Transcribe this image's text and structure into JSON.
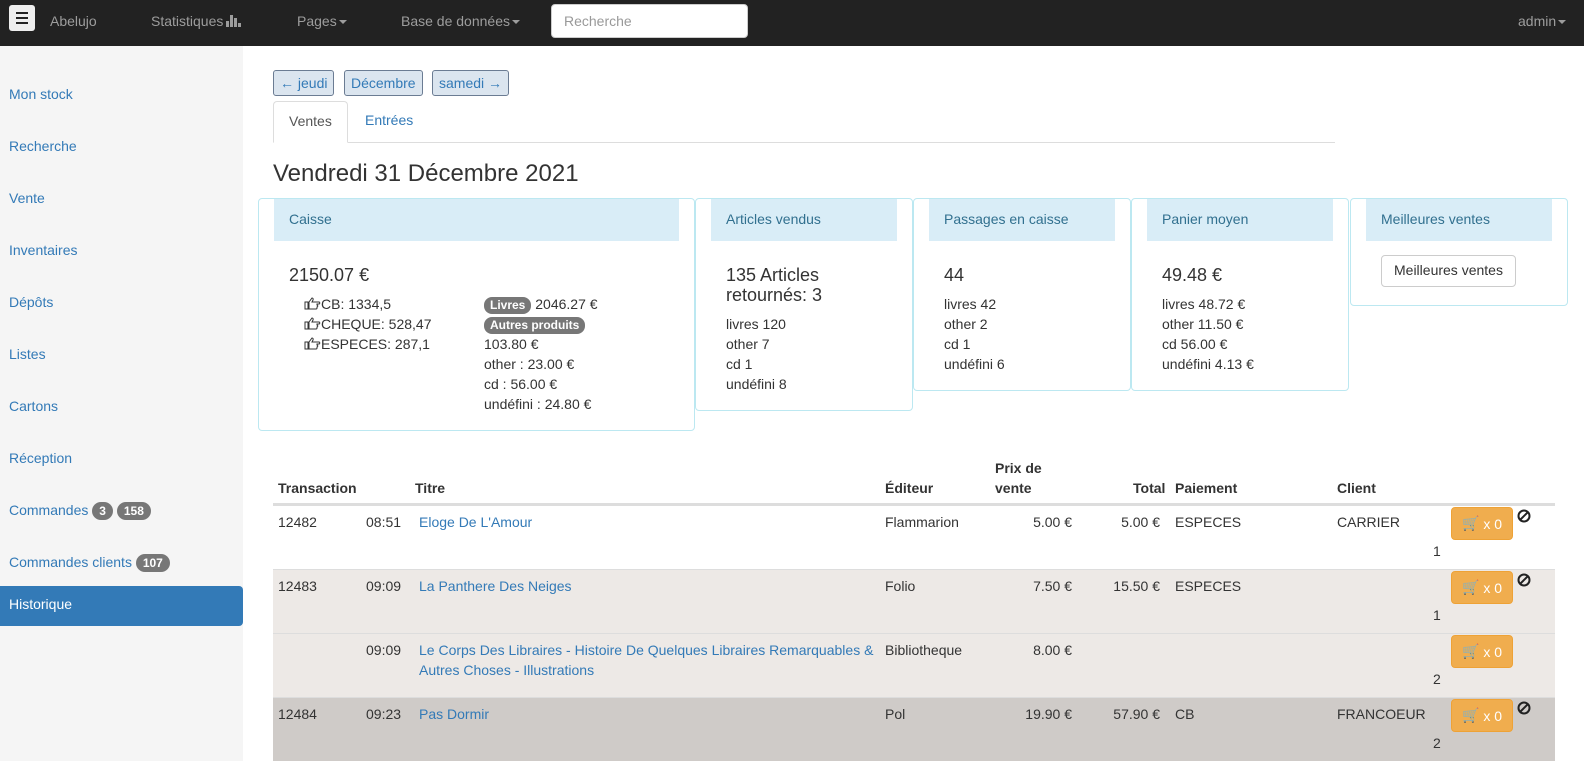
{
  "navbar": {
    "brand": "Abelujo",
    "statistiques": "Statistiques",
    "pages": "Pages",
    "base": "Base de données",
    "search_placeholder": "Recherche",
    "user": "admin"
  },
  "sidebar": {
    "items": [
      {
        "label": "Mon stock"
      },
      {
        "label": "Recherche"
      },
      {
        "label": "Vente"
      },
      {
        "label": "Inventaires"
      },
      {
        "label": "Dépôts"
      },
      {
        "label": "Listes"
      },
      {
        "label": "Cartons"
      },
      {
        "label": "Réception"
      },
      {
        "label": "Commandes",
        "badges": [
          "3",
          "158"
        ]
      },
      {
        "label": "Commandes clients",
        "badges": [
          "107"
        ]
      },
      {
        "label": "Historique"
      }
    ]
  },
  "pager": {
    "prev": "← jeudi",
    "month": "Décembre",
    "next": "samedi →"
  },
  "tabs": {
    "ventes": "Ventes",
    "entrees": "Entrées"
  },
  "title": "Vendredi 31 Décembre 2021",
  "caisse": {
    "heading": "Caisse",
    "total": "2150.07 €",
    "cb": "CB: 1334,5",
    "cheque": "CHEQUE: 528,47",
    "especes": "ESPECES: 287,1",
    "livres_label": "Livres",
    "livres_value": "2046.27 €",
    "autres_label": "Autres produits",
    "autres_value": "103.80 €",
    "other": "other : 23.00 €",
    "cd": "cd : 56.00 €",
    "undefini": "undéfini : 24.80 €"
  },
  "articles": {
    "heading": "Articles vendus",
    "line1": "135   Articles",
    "line2": "retournés: 3",
    "livres": "livres 120",
    "other": "other 7",
    "cd": "cd 1",
    "undefini": "undéfini 8"
  },
  "passages": {
    "heading": "Passages en caisse",
    "total": "44",
    "livres": "livres 42",
    "other": "other 2",
    "cd": "cd 1",
    "undefini": "undéfini 6"
  },
  "panier": {
    "heading": "Panier moyen",
    "total": "49.48 €",
    "livres": "livres 48.72 €",
    "other": "other 11.50 €",
    "cd": "cd 56.00 €",
    "undefini": "undéfini 4.13 €"
  },
  "meilleures": {
    "heading": "Meilleures ventes",
    "button": "Meilleures ventes"
  },
  "table": {
    "headers": {
      "transaction": "Transaction",
      "titre": "Titre",
      "editeur": "Éditeur",
      "prix1": "Prix de",
      "prix2": "vente",
      "total": "Total",
      "paiement": "Paiement",
      "client": "Client"
    },
    "rows": [
      {
        "id": "12482",
        "time": "08:51",
        "title": "Eloge De L'Amour",
        "editeur": "Flammarion",
        "prix": "5.00 €",
        "total": "5.00 €",
        "paiement": "ESPECES",
        "client": "CARRIER",
        "cart": "x 0",
        "qty": "1"
      },
      {
        "id": "12483",
        "time": "09:09",
        "title": "La Panthere Des Neiges",
        "editeur": "Folio",
        "prix": "7.50 €",
        "total": "15.50 €",
        "paiement": "ESPECES",
        "client": "",
        "cart": "x 0",
        "qty": "1"
      },
      {
        "id": "",
        "time": "09:09",
        "title": "Le Corps Des Libraires - Histoire De Quelques Libraires Remarquables & Autres Choses - Illustrations",
        "editeur": "Bibliotheque",
        "prix": "8.00 €",
        "total": "",
        "paiement": "",
        "client": "",
        "cart": "x 0",
        "qty": "2"
      },
      {
        "id": "12484",
        "time": "09:23",
        "title": "Pas Dormir",
        "editeur": "Pol",
        "prix": "19.90 €",
        "total": "57.90 €",
        "paiement": "CB",
        "client": "FRANCOEUR",
        "cart": "x 0",
        "qty": "2"
      }
    ]
  }
}
